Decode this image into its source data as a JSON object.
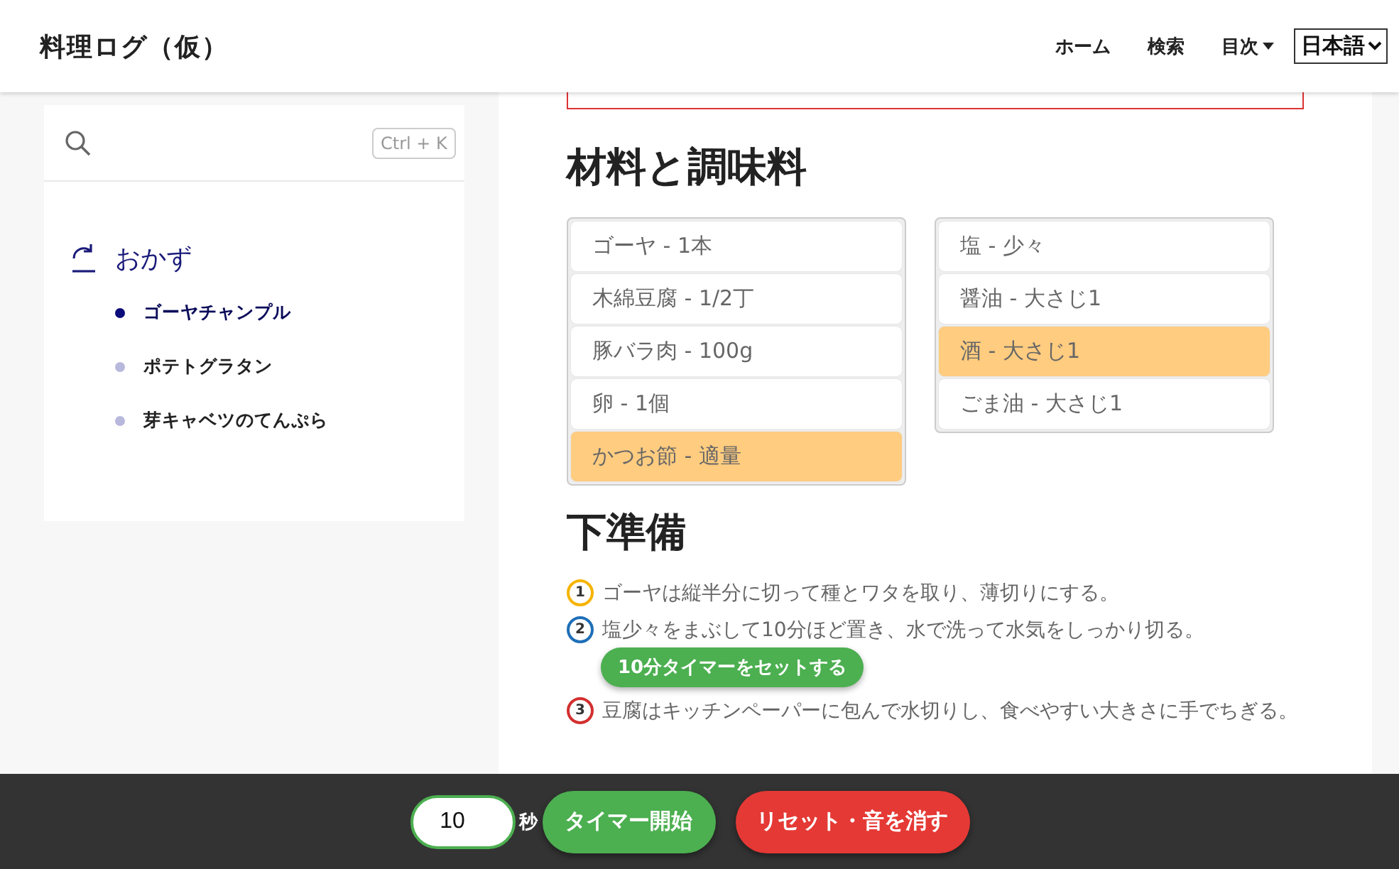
{
  "header": {
    "site_title": "料理ログ（仮）",
    "nav": [
      {
        "label": "ホーム",
        "kind": "link"
      },
      {
        "label": "検索",
        "kind": "link"
      },
      {
        "label": "目次",
        "kind": "dropdown"
      }
    ],
    "language_select": {
      "value": "日本語"
    }
  },
  "sidebar": {
    "search": {
      "shortcut": "Ctrl + K"
    },
    "category": {
      "label": "おかず",
      "items": [
        {
          "label": "ゴーヤチャンプル",
          "selected": true
        },
        {
          "label": "ポテトグラタン",
          "selected": false
        },
        {
          "label": "芽キャベツのてんぷら",
          "selected": false
        }
      ]
    }
  },
  "ingredients": {
    "heading": "材料と調味料",
    "columns": [
      {
        "items": [
          {
            "label": "ゴーヤ - 1本",
            "selected": false
          },
          {
            "label": "木綿豆腐 - 1/2丁",
            "selected": false
          },
          {
            "label": "豚バラ肉 - 100g",
            "selected": false
          },
          {
            "label": "卵 - 1個",
            "selected": false
          },
          {
            "label": "かつお節 - 適量",
            "selected": true
          }
        ]
      },
      {
        "items": [
          {
            "label": "塩 - 少々",
            "selected": false
          },
          {
            "label": "醤油 - 大さじ1",
            "selected": false
          },
          {
            "label": "酒 - 大さじ1",
            "selected": true
          },
          {
            "label": "ごま油 - 大さじ1",
            "selected": false
          }
        ]
      }
    ]
  },
  "preparation": {
    "heading": "下準備",
    "steps": [
      {
        "number": "1",
        "color": "#f5b400",
        "text": "ゴーヤは縦半分に切って種とワタを取り、薄切りにする。"
      },
      {
        "number": "2",
        "color": "#1e6fb8",
        "text": "塩少々をまぶして10分ほど置き、水で洗って水気をしっかり切る。",
        "button": "10分タイマーをセットする"
      },
      {
        "number": "3",
        "color": "#d32f2f",
        "text": "豆腐はキッチンペーパーに包んで水切りし、食べやすい大きさに手でちぎる。"
      }
    ]
  },
  "timer_bar": {
    "seconds_value": "10",
    "unit": "秒",
    "start_button": "タイマー開始",
    "reset_button": "リセット・音を消す"
  }
}
